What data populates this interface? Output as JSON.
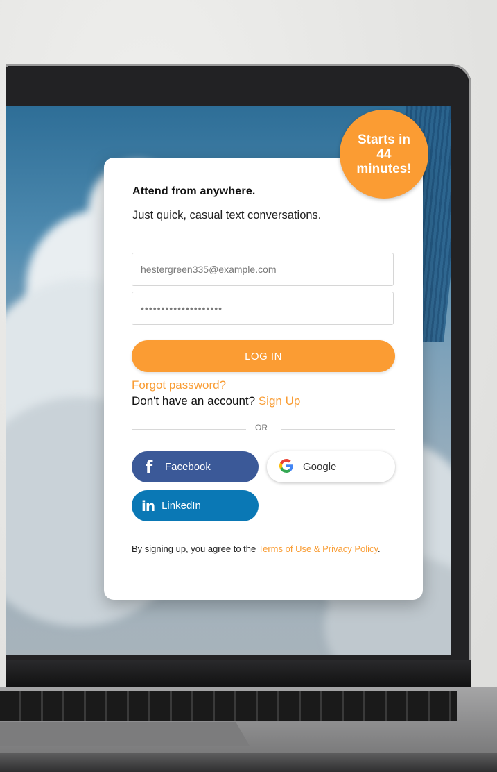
{
  "hero": {
    "headline": "Attend from anywhere.",
    "subline": "Just quick, casual text conversations."
  },
  "badge": {
    "line1": "Starts in",
    "line2": "44",
    "line3": "minutes!"
  },
  "form": {
    "email_value": "hestergreen335@example.com",
    "password_value": "••••••••••••••••••••",
    "login_label": "LOG IN",
    "forgot_label": "Forgot password?",
    "no_account_text": "Don't have an account?",
    "signup_label": "Sign Up",
    "divider_text": "OR"
  },
  "social": {
    "facebook_label": "Facebook",
    "google_label": "Google",
    "linkedin_label": "LinkedIn"
  },
  "terms": {
    "prefix": "By signing up, you agree to the",
    "link": "Terms of Use & Privacy Policy",
    "suffix": "."
  },
  "colors": {
    "accent": "#fb9c33",
    "facebook": "#3b5998",
    "linkedin": "#0a78b5"
  },
  "icons": [
    "facebook-icon",
    "google-icon",
    "linkedin-icon"
  ]
}
